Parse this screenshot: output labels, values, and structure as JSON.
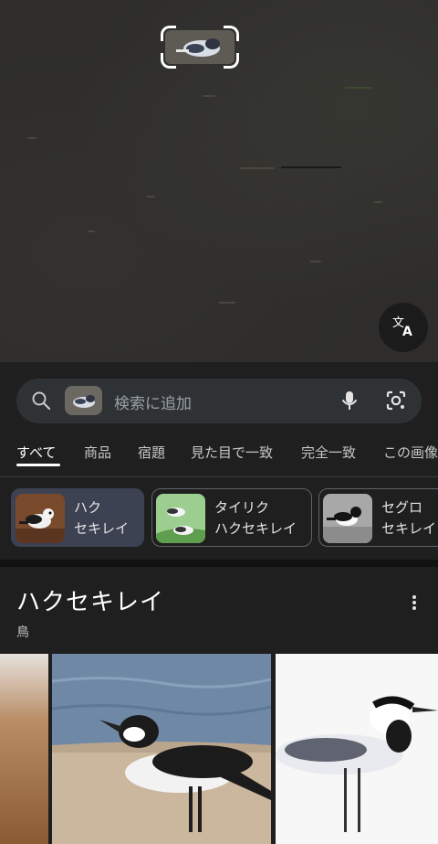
{
  "photo": {
    "crop_target": "bird-in-selection",
    "translate_button_icon": "translate-icon"
  },
  "search": {
    "placeholder": "検索に追加",
    "mic_icon": "mic-icon",
    "lens_icon": "lens-camera-icon"
  },
  "tabs": [
    {
      "label": "すべて",
      "active": true
    },
    {
      "label": "商品",
      "active": false
    },
    {
      "label": "宿題",
      "active": false
    },
    {
      "label": "見た目で一致",
      "active": false
    },
    {
      "label": "完全一致",
      "active": false
    },
    {
      "label": "この画像",
      "active": false
    }
  ],
  "chips": [
    {
      "line1": "ハク",
      "line2": "セキレイ",
      "selected": true
    },
    {
      "line1": "タイリク",
      "line2": "ハクセキレイ",
      "selected": false
    },
    {
      "line1": "セグロ",
      "line2": "セキレイ",
      "selected": false
    }
  ],
  "knowledge": {
    "title": "ハクセキレイ",
    "subtitle": "鳥",
    "more_icon": "more-vert-icon"
  },
  "colors": {
    "background": "#1f1f1f",
    "search_bar": "#2f3235",
    "selected_chip": "#3c4252",
    "accent_text": "#ffffff"
  }
}
